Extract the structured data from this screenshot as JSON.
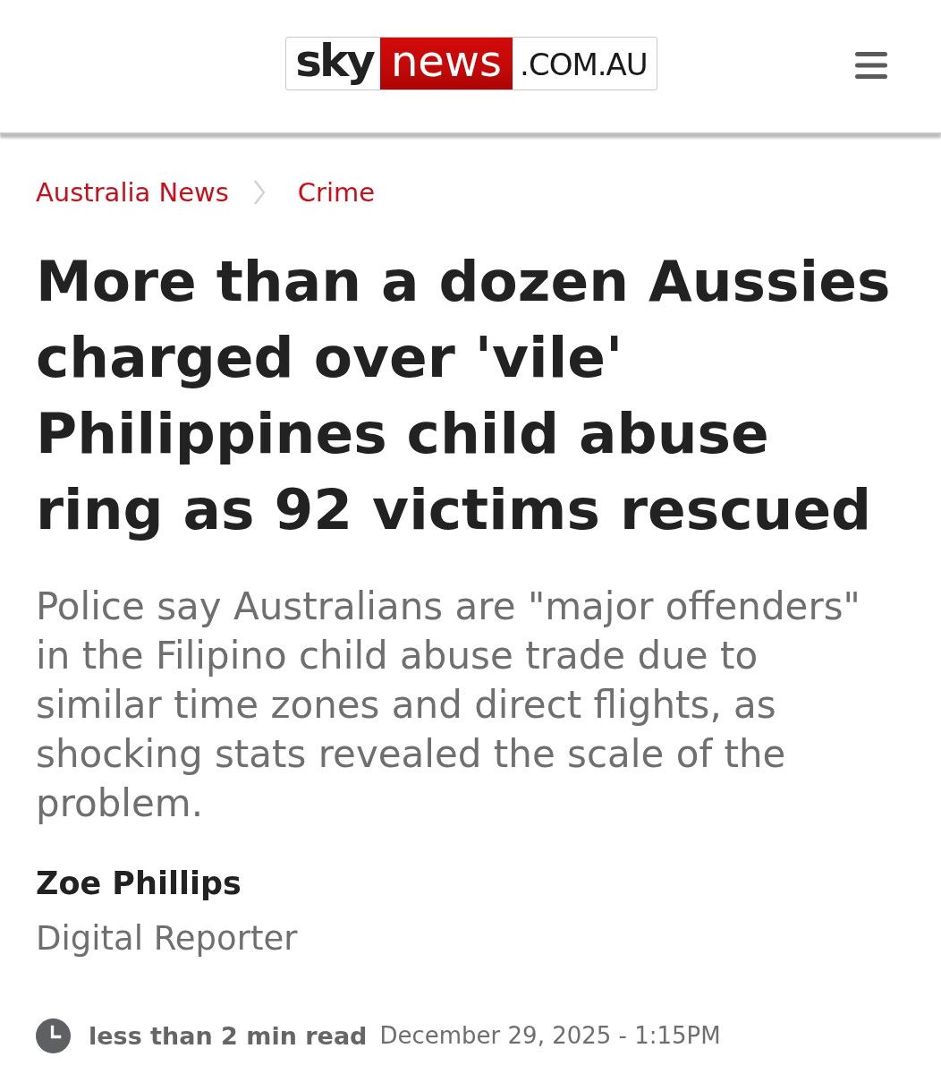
{
  "header": {
    "logo": {
      "parts": [
        {
          "kind": "plain",
          "text": "sky"
        },
        {
          "kind": "boxed",
          "text": "news"
        },
        {
          "kind": "suffix",
          "text": ".COM.AU"
        }
      ]
    }
  },
  "breadcrumbs": [
    {
      "label": "Australia News"
    },
    {
      "label": "Crime"
    }
  ],
  "article": {
    "headline": "More than a dozen Aussies charged over 'vile' Philippines child abuse ring as 92 victims rescued",
    "standfirst": "Police say Australians are \"major offenders\" in the Filipino child abuse trade due to similar time zones and direct flights, as shocking stats revealed the scale of the problem.",
    "author": {
      "name": "Zoe Phillips",
      "role": "Digital Reporter"
    },
    "meta": {
      "read_time": "less than 2 min read",
      "date": "December 29, 2025 - 1:15PM"
    }
  }
}
